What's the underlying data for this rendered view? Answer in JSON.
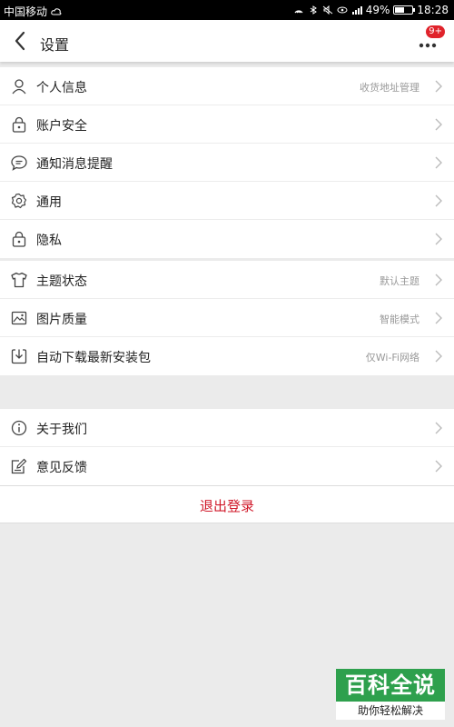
{
  "status_bar": {
    "carrier": "中国移动",
    "battery": "49%",
    "time": "18:28"
  },
  "header": {
    "title": "设置",
    "badge": "9+"
  },
  "section1": [
    {
      "label": "个人信息",
      "value": "收货地址管理",
      "icon": "person-icon"
    },
    {
      "label": "账户安全",
      "value": "",
      "icon": "lock-icon"
    },
    {
      "label": "通知消息提醒",
      "value": "",
      "icon": "chat-bubble-icon"
    },
    {
      "label": "通用",
      "value": "",
      "icon": "gear-icon"
    },
    {
      "label": "隐私",
      "value": "",
      "icon": "lock-icon"
    }
  ],
  "section2": [
    {
      "label": "主题状态",
      "value": "默认主题",
      "icon": "shirt-icon"
    },
    {
      "label": "图片质量",
      "value": "智能模式",
      "icon": "image-icon"
    },
    {
      "label": "自动下载最新安装包",
      "value": "仅Wi-Fi网络",
      "icon": "download-icon"
    }
  ],
  "section3": [
    {
      "label": "关于我们",
      "value": "",
      "icon": "info-icon"
    },
    {
      "label": "意见反馈",
      "value": "",
      "icon": "edit-icon"
    }
  ],
  "logout_label": "退出登录",
  "watermark": {
    "title": "百科全说",
    "subtitle": "助你轻松解决"
  }
}
